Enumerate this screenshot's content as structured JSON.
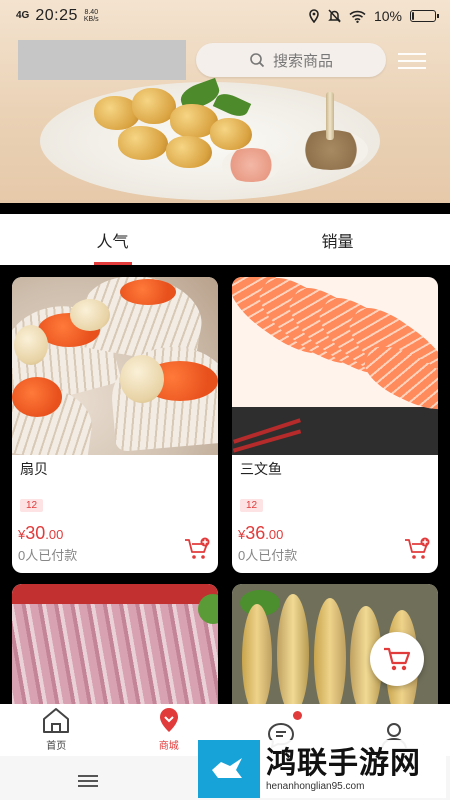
{
  "status_bar": {
    "signal": "4G",
    "time": "20:25",
    "net_speed_value": "8.40",
    "net_speed_unit": "KB/s",
    "battery": "10%",
    "battery_level": 0.1
  },
  "header": {
    "search_placeholder": "搜索商品"
  },
  "tabs": [
    {
      "label": "人气",
      "active": true
    },
    {
      "label": "销量",
      "active": false
    }
  ],
  "products": [
    {
      "name": "扇贝",
      "tag": "12",
      "currency": "¥",
      "price_int": "30",
      "price_dec": ".00",
      "sold": "0人已付款"
    },
    {
      "name": "三文鱼",
      "tag": "12",
      "currency": "¥",
      "price_int": "36",
      "price_dec": ".00",
      "sold": "0人已付款"
    }
  ],
  "bottom_nav": [
    {
      "label": "首页",
      "icon": "home-icon",
      "active": false
    },
    {
      "label": "商城",
      "icon": "shop-icon",
      "active": true
    },
    {
      "label": "",
      "icon": "message-icon",
      "active": false,
      "badge": true
    },
    {
      "label": "",
      "icon": "user-icon",
      "active": false
    }
  ],
  "watermark": {
    "title": "鸿联手游网",
    "url": "henanhonglian95.com"
  },
  "colors": {
    "accent": "#e23b3b",
    "background": "#000000",
    "watermark_blue": "#17a3d8"
  }
}
